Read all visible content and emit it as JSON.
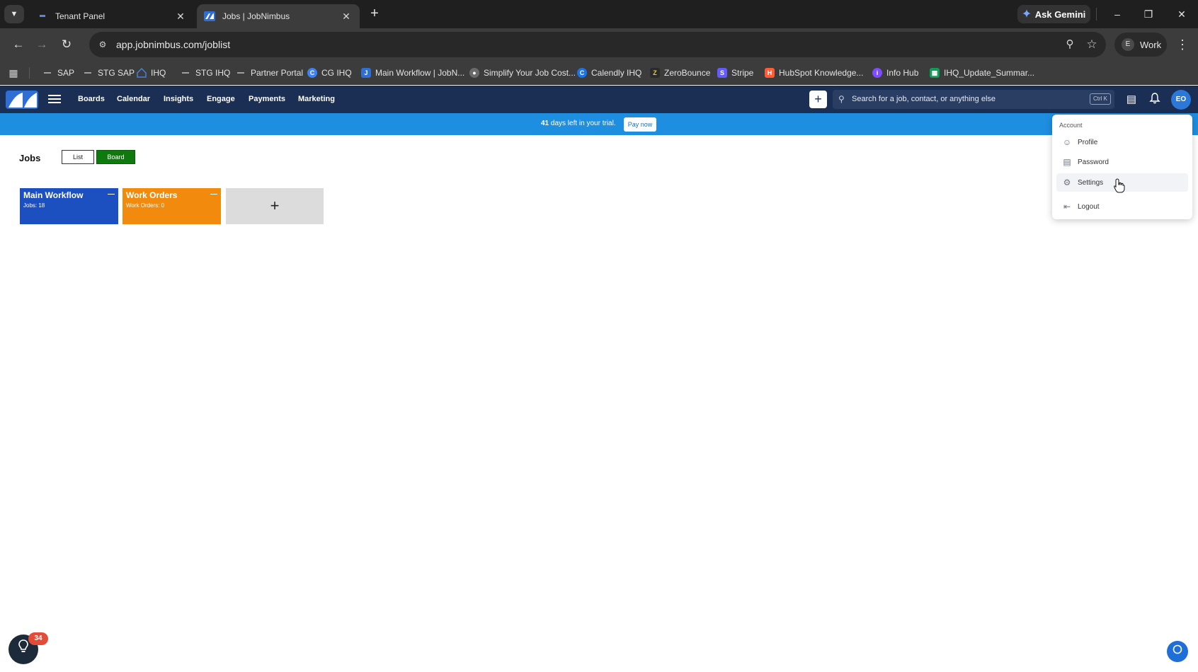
{
  "browser": {
    "tabs": [
      {
        "title": "Tenant Panel",
        "active": false
      },
      {
        "title": "Jobs | JobNimbus",
        "active": true
      }
    ],
    "gemini_label": "Ask Gemini",
    "url": "app.jobnimbus.com/joblist",
    "profile_badge": "E",
    "profile_label": "Work"
  },
  "bookmarks": [
    {
      "label": "SAP",
      "icon": "dash-icon",
      "color": "#9aa0a6"
    },
    {
      "label": "STG SAP",
      "icon": "dash-icon",
      "color": "#9aa0a6"
    },
    {
      "label": "IHQ",
      "icon": "house-icon",
      "color": "#4a7fd8"
    },
    {
      "label": "STG IHQ",
      "icon": "dash-icon",
      "color": "#9aa0a6"
    },
    {
      "label": "Partner Portal",
      "icon": "dash-icon",
      "color": "#9aa0a6"
    },
    {
      "label": "CG IHQ",
      "icon": "circle-icon",
      "color": "#3b82f6"
    },
    {
      "label": "Main Workflow | JobN...",
      "icon": "jobnimbus-icon",
      "color": "#2f6fd3"
    },
    {
      "label": "Simplify Your Job Cost...",
      "icon": "globe-icon",
      "color": "#8a8a8a"
    },
    {
      "label": "Calendly IHQ",
      "icon": "calendly-icon",
      "color": "#1a73e8"
    },
    {
      "label": "ZeroBounce",
      "icon": "zerobounce-icon",
      "color": "#2a2a2a"
    },
    {
      "label": "Stripe",
      "icon": "stripe-icon",
      "color": "#635bff"
    },
    {
      "label": "HubSpot Knowledge...",
      "icon": "hubspot-icon",
      "color": "#ff5c35"
    },
    {
      "label": "Info Hub",
      "icon": "infohub-icon",
      "color": "#7c4dff"
    },
    {
      "label": "IHQ_Update_Summar...",
      "icon": "sheets-icon",
      "color": "#0f9d58"
    }
  ],
  "app": {
    "nav": [
      "Boards",
      "Calendar",
      "Insights",
      "Engage",
      "Payments",
      "Marketing"
    ],
    "search_placeholder": "Search for a job, contact, or anything else",
    "search_shortcut": "Ctrl K",
    "avatar_initials": "EO",
    "brand_color": "#1b2f55",
    "banner": {
      "days": "41",
      "text": "days left in your trial.",
      "button": "Pay now",
      "color": "#1e8ee0"
    }
  },
  "page": {
    "title": "Jobs",
    "view_toggle": {
      "list": "List",
      "board": "Board",
      "selected": "Board"
    },
    "boards": [
      {
        "title": "Main Workflow",
        "count_label": "Jobs: 18",
        "color": "#1c4fbf"
      },
      {
        "title": "Work Orders",
        "count_label": "Work Orders: 0",
        "color": "#f28a0e"
      }
    ],
    "add_board_label": "+"
  },
  "account_menu": {
    "header": "Account",
    "items": [
      {
        "label": "Profile",
        "icon": "profile-icon"
      },
      {
        "label": "Password",
        "icon": "password-icon"
      },
      {
        "label": "Settings",
        "icon": "gear-icon",
        "hovered": true
      },
      {
        "label": "Logout",
        "icon": "logout-icon"
      }
    ]
  },
  "widgets": {
    "tips_badge": "34"
  }
}
